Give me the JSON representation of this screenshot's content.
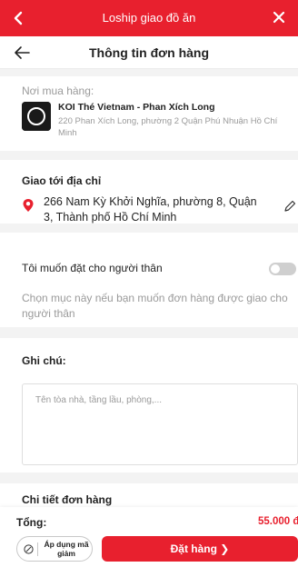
{
  "colors": {
    "primary": "#e8202e",
    "muted": "#9a9a9a",
    "text": "#222222"
  },
  "topbar": {
    "title": "Loship giao đồ ăn",
    "back_icon": "chevron-left-icon",
    "close_icon": "close-icon"
  },
  "header": {
    "title": "Thông tin đơn hàng",
    "back_icon": "arrow-left-icon"
  },
  "store": {
    "label": "Nơi mua hàng:",
    "name": "KOI Thé Vietnam - Phan Xích Long",
    "address": "220 Phan Xích Long, phường 2 Quận Phú Nhuận Hồ Chí Minh"
  },
  "delivery": {
    "label": "Giao tới địa chỉ",
    "address": "266 Nam Kỳ Khởi Nghĩa, phường 8, Quận 3, Thành phố Hồ Chí Minh",
    "pin_icon": "location-pin-icon",
    "edit_icon": "pencil-icon"
  },
  "relative_order": {
    "label": "Tôi muốn đặt cho người thân",
    "enabled": false,
    "hint": "Chọn mục này nếu bạn muốn đơn hàng được giao cho người thân"
  },
  "note": {
    "label": "Ghi chú:",
    "placeholder": "Tên tòa nhà, tầng lầu, phòng,..."
  },
  "details": {
    "label": "Chi tiết đơn hàng"
  },
  "footer": {
    "total_label": "Tổng:",
    "total_value": "55.000 đ",
    "voucher_label": "Áp dụng mã giảm",
    "order_label": "Đặt hàng ❯"
  }
}
